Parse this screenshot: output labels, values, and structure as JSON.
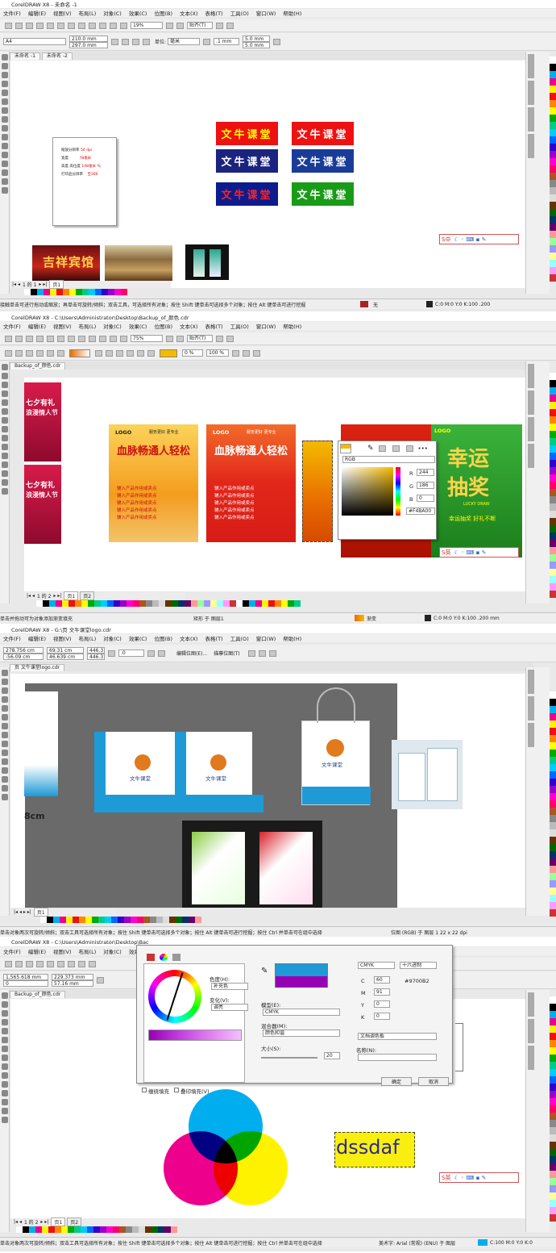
{
  "p1": {
    "title": "CorelDRAW X8 - 未命名 -1",
    "menu": [
      "文件(F)",
      "编辑(E)",
      "视图(V)",
      "布局(L)",
      "对象(C)",
      "效果(C)",
      "位图(B)",
      "文本(X)",
      "表格(T)",
      "工具(O)",
      "窗口(W)",
      "帮助(H)"
    ],
    "zoom": "19%",
    "snap": "贴齐(T)",
    "page_size": "A4",
    "width": "210.0 mm",
    "height": "297.0 mm",
    "units_label": "单位:",
    "units": "毫米",
    "nudge": ".1 mm",
    "dup_x": "5.0 mm",
    "dup_y": "5.0 mm",
    "tabs": [
      "未命名 -1",
      "未命名 -2"
    ],
    "doc": {
      "l1": "缩放分辨率",
      "v1": "50 dpi",
      "l2": "宽度",
      "v2": "78毫米",
      "l3": "高度 高位度",
      "v3": "148毫米 ％",
      "l4": "打印品分辨率",
      "v4": "至300"
    },
    "logo_text": "文牛课堂",
    "photo1_text": "吉祥宾馆",
    "page_nav": "1 的 1",
    "page_tab": "页1",
    "ime": "S中",
    "status": "接触单击可进行拖动或缩放；再单击可旋转/倾斜；双击工具，可选择所有对象；按住 Shift 键单击可选择多个对象；按住 Alt 键单击可进行挖掘",
    "status_fill": "无",
    "status_color": "C:0 M:0 Y:0 K:100  .200"
  },
  "p2": {
    "title": "CorelDRAW X8 - C:\\Users\\Administrator\\Desktop\\Backup_of_颜色.cdr",
    "menu": [
      "文件(F)",
      "编辑(E)",
      "视图(V)",
      "布局(L)",
      "对象(C)",
      "效果(C)",
      "位图(B)",
      "文本(X)",
      "表格(T)",
      "工具(O)",
      "窗口(W)",
      "帮助(H)"
    ],
    "zoom": "75%",
    "snap": "贴齐(T)",
    "opacity": "0 %",
    "opacity2": "100 %",
    "tab": "Backup_of_颜色.cdr",
    "poster_top": "七夕有礼",
    "poster_mid": "浪漫情人节",
    "flyer_logo": "LOGO",
    "flyer_slogan": "服务更好 更专业",
    "flyer_title": "血脉畅通人轻松",
    "flyer_lines": [
      "辅入产品作用或卖点",
      "辅入产品作用或卖点",
      "辅入产品作用或卖点",
      "辅入产品作用或卖点",
      "辅入产品作用或卖点"
    ],
    "picker_mode": "RGB",
    "r": "244",
    "g": "186",
    "b": "0",
    "hex": "#F4BA00",
    "lottery_logo": "LOGO",
    "lottery_title1": "幸运",
    "lottery_title2": "抽奖",
    "lottery_sub": "LUCKY DRAW",
    "lottery_foot": "幸运抽奖 好礼不断",
    "page_nav": "1 的 2",
    "page_tabs": [
      "页1",
      "页2"
    ],
    "ime": "S英",
    "status": "单击并拖动可为对象添加渐变填充",
    "status_obj": "矩形 于 图层1",
    "status_fill": "渐变",
    "status_color": "C:0 M:0 Y:0 K:100  .200 mm"
  },
  "p3": {
    "title": "CorelDRAW X8 - G:\\页 文牛课堂logo.cdr",
    "menu": [
      "文件(F)",
      "编辑(E)",
      "视图(V)",
      "布局(L)",
      "对象(C)",
      "效果(C)",
      "位图(B)",
      "文本(X)",
      "表格(T)",
      "工具(O)",
      "窗口(W)",
      "帮助(H)"
    ],
    "x": "278.756 cm",
    "y": "-56.09 cm",
    "w": "69.31 cm",
    "h": "46.639 cm",
    "sx": "446.3",
    "sy": "446.3",
    "angle": ".0",
    "edit_bitmap": "编辑位图(E)...",
    "trace_bitmap": "描摹位图(T)",
    "tab": "页 文牛课堂logo.cdr",
    "brand": "文牛课堂",
    "logo": "LOGO",
    "size_label": "8cm",
    "page_tab": "页1",
    "status": "单击对象两次可旋转/倾斜；双击工具可选择所有对象；按住 Shift 键单击可选择多个对象；按住 Alt 键单击可进行挖掘；按住 Ctrl 并单击可在组中选择",
    "status_right": "位图 (RGB) 于 图层 1 22 x 22 dpi"
  },
  "p4": {
    "title": "CorelDRAW X8 - C:\\Users\\Administrator\\Desktop\\Bac",
    "menu": [
      "文件(F)",
      "编辑(E)",
      "视图(V)",
      "布局(L)",
      "对象(C)",
      "效果(C)",
      "位图"
    ],
    "x": "1,565.618 mm",
    "y": "0",
    "w": "229.373 mm",
    "h": "57.16 mm",
    "tab": "Backup_of_颜色.cdr",
    "harmony_label": "色度(H):",
    "harmony": "补充色",
    "variation_label": "变化(V):",
    "variation": "调亮",
    "model_label": "模型(E):",
    "model": "CMYK",
    "mixer_label": "混合器(M):",
    "mixer": "颜色和谐",
    "size_label": "大小(S):",
    "size": "20",
    "cmyk_mode": "CMYK",
    "hex_mode": "十六进制",
    "c": "60",
    "m": "91",
    "k": "0",
    "hex": "#9700B2",
    "palette_label": "文档调色板",
    "name_label": "名称(N):",
    "wrap_fill": "缠绕填充",
    "overprint": "叠印填充(V)",
    "ok": "确定",
    "cancel": "取消",
    "text_obj": "dssdaf",
    "page_nav": "1 的 2",
    "page_tabs": [
      "页1",
      "页2"
    ],
    "ime": "S英",
    "status": "单击对象两次可旋转/倾斜；双击工具可选择所有对象；按住 Shift 键单击可选择多个对象；按住 Alt 键单击可进行挖掘；按住 Ctrl 并单击可在组中选择",
    "status_right": "美术字: Arial (常规) (ENU) 于 图层",
    "status_color": "C:100 M:0 Y:0 K:0"
  }
}
